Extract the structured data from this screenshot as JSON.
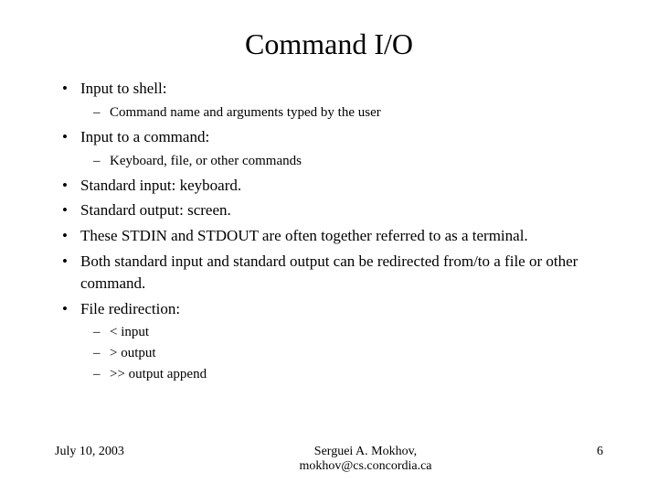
{
  "title": "Command I/O",
  "bullets": {
    "b1": "Input to shell:",
    "b1_sub1": "Command name and arguments typed by the user",
    "b2": "Input to a command:",
    "b2_sub1": "Keyboard, file, or other commands",
    "b3": "Standard input: keyboard.",
    "b4": "Standard output: screen.",
    "b5": "These STDIN and STDOUT are often together referred to as a terminal.",
    "b6": "Both standard input and standard output can be redirected from/to a file or other command.",
    "b7": "File redirection:",
    "b7_sub1": "< input",
    "b7_sub2": "> output",
    "b7_sub3": ">> output append"
  },
  "footer": {
    "date": "July 10, 2003",
    "author": "Serguei A. Mokhov,",
    "email": "mokhov@cs.concordia.ca",
    "page": "6"
  }
}
